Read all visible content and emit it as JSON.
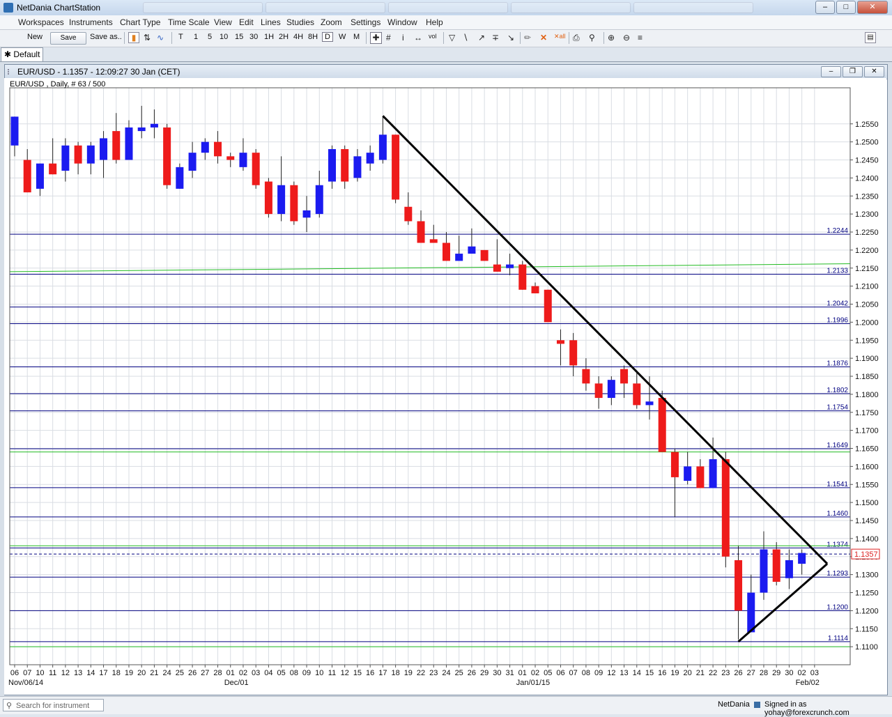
{
  "app": {
    "title": "NetDania ChartStation"
  },
  "menu": [
    "Workspaces",
    "Instruments",
    "Chart Type",
    "Time Scale",
    "View",
    "Edit",
    "Lines",
    "Studies",
    "Zoom",
    "Settings",
    "Window",
    "Help"
  ],
  "toolbar": {
    "new_label": "New",
    "save_label": "Save",
    "saveas_label": "Save as..",
    "timeframes": [
      "T",
      "1",
      "5",
      "10",
      "15",
      "30",
      "1H",
      "2H",
      "4H",
      "8H",
      "D",
      "W",
      "M"
    ]
  },
  "workspace_tab": {
    "label": "Default"
  },
  "chart_window": {
    "title": "EUR/USD - 1.1357 - 12:09:27  30 Jan (CET)"
  },
  "status": {
    "search_placeholder": "Search for instrument",
    "provider": "NetDania",
    "signed_in": "Signed in as yohay@forexcrunch.com"
  },
  "colors": {
    "up": "#1b1bf0",
    "down": "#ee1b1b",
    "hline": "#000080",
    "ma": "#22bb22",
    "trend": "#000000"
  },
  "chart_data": {
    "type": "candlestick",
    "info_label": "EUR/USD , Daily, # 63 / 500",
    "ylim": [
      1.105,
      1.265
    ],
    "y_ticks": [
      "1.1100",
      "1.1150",
      "1.1200",
      "1.1250",
      "1.1300",
      "1.1350",
      "1.1400",
      "1.1450",
      "1.1500",
      "1.1550",
      "1.1600",
      "1.1650",
      "1.1700",
      "1.1750",
      "1.1800",
      "1.1850",
      "1.1900",
      "1.1950",
      "1.2000",
      "1.2050",
      "1.2100",
      "1.2150",
      "1.2200",
      "1.2250",
      "1.2300",
      "1.2350",
      "1.2400",
      "1.2450",
      "1.2500",
      "1.2550"
    ],
    "x_day_labels": [
      "06",
      "07",
      "10",
      "11",
      "12",
      "13",
      "14",
      "17",
      "18",
      "19",
      "20",
      "21",
      "24",
      "25",
      "26",
      "27",
      "28",
      "01",
      "02",
      "03",
      "04",
      "05",
      "08",
      "09",
      "10",
      "11",
      "12",
      "15",
      "16",
      "17",
      "18",
      "19",
      "22",
      "23",
      "24",
      "25",
      "26",
      "29",
      "30",
      "31",
      "01",
      "02",
      "05",
      "06",
      "07",
      "08",
      "09",
      "12",
      "13",
      "14",
      "15",
      "16",
      "19",
      "20",
      "21",
      "22",
      "23",
      "26",
      "27",
      "28",
      "29",
      "30",
      "02",
      "03"
    ],
    "x_month_labels": [
      {
        "index": 0,
        "text": "Nov/06/14"
      },
      {
        "index": 17,
        "text": "Dec/01"
      },
      {
        "index": 40,
        "text": "Jan/01/15"
      },
      {
        "index": 62,
        "text": "Feb/02"
      }
    ],
    "candles": [
      {
        "o": 1.249,
        "h": 1.256,
        "l": 1.246,
        "c": 1.257
      },
      {
        "o": 1.245,
        "h": 1.248,
        "l": 1.236,
        "c": 1.236
      },
      {
        "o": 1.237,
        "h": 1.244,
        "l": 1.235,
        "c": 1.244
      },
      {
        "o": 1.244,
        "h": 1.251,
        "l": 1.241,
        "c": 1.241
      },
      {
        "o": 1.242,
        "h": 1.251,
        "l": 1.239,
        "c": 1.249
      },
      {
        "o": 1.249,
        "h": 1.25,
        "l": 1.241,
        "c": 1.244
      },
      {
        "o": 1.244,
        "h": 1.25,
        "l": 1.241,
        "c": 1.249
      },
      {
        "o": 1.245,
        "h": 1.253,
        "l": 1.24,
        "c": 1.251
      },
      {
        "o": 1.253,
        "h": 1.258,
        "l": 1.244,
        "c": 1.245
      },
      {
        "o": 1.245,
        "h": 1.256,
        "l": 1.245,
        "c": 1.254
      },
      {
        "o": 1.253,
        "h": 1.26,
        "l": 1.251,
        "c": 1.254
      },
      {
        "o": 1.254,
        "h": 1.259,
        "l": 1.251,
        "c": 1.255
      },
      {
        "o": 1.254,
        "h": 1.255,
        "l": 1.237,
        "c": 1.238
      },
      {
        "o": 1.237,
        "h": 1.244,
        "l": 1.237,
        "c": 1.243
      },
      {
        "o": 1.242,
        "h": 1.25,
        "l": 1.24,
        "c": 1.247
      },
      {
        "o": 1.247,
        "h": 1.251,
        "l": 1.245,
        "c": 1.25
      },
      {
        "o": 1.25,
        "h": 1.253,
        "l": 1.244,
        "c": 1.246
      },
      {
        "o": 1.246,
        "h": 1.247,
        "l": 1.243,
        "c": 1.245
      },
      {
        "o": 1.243,
        "h": 1.251,
        "l": 1.242,
        "c": 1.247
      },
      {
        "o": 1.247,
        "h": 1.248,
        "l": 1.237,
        "c": 1.238
      },
      {
        "o": 1.239,
        "h": 1.24,
        "l": 1.229,
        "c": 1.23
      },
      {
        "o": 1.23,
        "h": 1.246,
        "l": 1.228,
        "c": 1.238
      },
      {
        "o": 1.238,
        "h": 1.239,
        "l": 1.227,
        "c": 1.228
      },
      {
        "o": 1.229,
        "h": 1.235,
        "l": 1.225,
        "c": 1.231
      },
      {
        "o": 1.23,
        "h": 1.242,
        "l": 1.229,
        "c": 1.238
      },
      {
        "o": 1.239,
        "h": 1.249,
        "l": 1.237,
        "c": 1.248
      },
      {
        "o": 1.248,
        "h": 1.249,
        "l": 1.237,
        "c": 1.239
      },
      {
        "o": 1.24,
        "h": 1.248,
        "l": 1.239,
        "c": 1.246
      },
      {
        "o": 1.244,
        "h": 1.249,
        "l": 1.242,
        "c": 1.247
      },
      {
        "o": 1.245,
        "h": 1.257,
        "l": 1.244,
        "c": 1.252
      },
      {
        "o": 1.252,
        "h": 1.251,
        "l": 1.233,
        "c": 1.234
      },
      {
        "o": 1.232,
        "h": 1.236,
        "l": 1.227,
        "c": 1.228
      },
      {
        "o": 1.228,
        "h": 1.231,
        "l": 1.223,
        "c": 1.222
      },
      {
        "o": 1.223,
        "h": 1.227,
        "l": 1.222,
        "c": 1.222
      },
      {
        "o": 1.222,
        "h": 1.225,
        "l": 1.217,
        "c": 1.217
      },
      {
        "o": 1.217,
        "h": 1.224,
        "l": 1.217,
        "c": 1.219
      },
      {
        "o": 1.219,
        "h": 1.226,
        "l": 1.219,
        "c": 1.221
      },
      {
        "o": 1.22,
        "h": 1.22,
        "l": 1.217,
        "c": 1.217
      },
      {
        "o": 1.216,
        "h": 1.223,
        "l": 1.215,
        "c": 1.214
      },
      {
        "o": 1.215,
        "h": 1.219,
        "l": 1.213,
        "c": 1.216
      },
      {
        "o": 1.216,
        "h": 1.217,
        "l": 1.209,
        "c": 1.209
      },
      {
        "o": 1.21,
        "h": 1.211,
        "l": 1.208,
        "c": 1.208
      },
      {
        "o": 1.209,
        "h": 1.209,
        "l": 1.2,
        "c": 1.2
      },
      {
        "o": 1.195,
        "h": 1.198,
        "l": 1.188,
        "c": 1.194
      },
      {
        "o": 1.195,
        "h": 1.197,
        "l": 1.185,
        "c": 1.188
      },
      {
        "o": 1.187,
        "h": 1.19,
        "l": 1.181,
        "c": 1.183
      },
      {
        "o": 1.183,
        "h": 1.185,
        "l": 1.176,
        "c": 1.179
      },
      {
        "o": 1.179,
        "h": 1.185,
        "l": 1.177,
        "c": 1.184
      },
      {
        "o": 1.187,
        "h": 1.188,
        "l": 1.179,
        "c": 1.183
      },
      {
        "o": 1.183,
        "h": 1.186,
        "l": 1.176,
        "c": 1.177
      },
      {
        "o": 1.177,
        "h": 1.185,
        "l": 1.173,
        "c": 1.178
      },
      {
        "o": 1.179,
        "h": 1.181,
        "l": 1.164,
        "c": 1.164
      },
      {
        "o": 1.164,
        "h": 1.165,
        "l": 1.146,
        "c": 1.157
      },
      {
        "o": 1.156,
        "h": 1.164,
        "l": 1.155,
        "c": 1.16
      },
      {
        "o": 1.16,
        "h": 1.162,
        "l": 1.154,
        "c": 1.154
      },
      {
        "o": 1.154,
        "h": 1.168,
        "l": 1.154,
        "c": 1.162
      },
      {
        "o": 1.162,
        "h": 1.164,
        "l": 1.132,
        "c": 1.135
      },
      {
        "o": 1.134,
        "h": 1.138,
        "l": 1.112,
        "c": 1.12
      },
      {
        "o": 1.114,
        "h": 1.13,
        "l": 1.115,
        "c": 1.125
      },
      {
        "o": 1.125,
        "h": 1.142,
        "l": 1.123,
        "c": 1.137
      },
      {
        "o": 1.137,
        "h": 1.139,
        "l": 1.127,
        "c": 1.128
      },
      {
        "o": 1.129,
        "h": 1.137,
        "l": 1.126,
        "c": 1.134
      },
      {
        "o": 1.133,
        "h": 1.137,
        "l": 1.13,
        "c": 1.136
      }
    ],
    "horizontal_lines": [
      {
        "value": 1.2244,
        "label": "1.2244"
      },
      {
        "value": 1.2133,
        "label": "1.2133"
      },
      {
        "value": 1.2042,
        "label": "1.2042"
      },
      {
        "value": 1.1996,
        "label": "1.1996"
      },
      {
        "value": 1.1876,
        "label": "1.1876"
      },
      {
        "value": 1.1802,
        "label": "1.1802"
      },
      {
        "value": 1.1754,
        "label": "1.1754"
      },
      {
        "value": 1.1649,
        "label": "1.1649"
      },
      {
        "value": 1.1541,
        "label": "1.1541"
      },
      {
        "value": 1.146,
        "label": "1.1460"
      },
      {
        "value": 1.1374,
        "label": "1.1374"
      },
      {
        "value": 1.1293,
        "label": "1.1293"
      },
      {
        "value": 1.12,
        "label": "1.1200"
      },
      {
        "value": 1.1114,
        "label": "1.1114"
      }
    ],
    "green_lines": [
      {
        "from": {
          "i": 0,
          "v": 1.214
        },
        "to": {
          "i": 63,
          "v": 1.2162
        }
      },
      {
        "from": {
          "i": 0,
          "v": 1.164
        },
        "to": {
          "i": 63,
          "v": 1.164
        }
      },
      {
        "from": {
          "i": 0,
          "v": 1.138
        },
        "to": {
          "i": 63,
          "v": 1.138
        }
      },
      {
        "from": {
          "i": 0,
          "v": 1.11
        },
        "to": {
          "i": 63,
          "v": 1.11
        }
      }
    ],
    "trend_lines": [
      {
        "from": {
          "i": 29,
          "v": 1.2572
        },
        "to": {
          "i": 64,
          "v": 1.133
        }
      },
      {
        "from": {
          "i": 57,
          "v": 1.1114
        },
        "to": {
          "i": 64,
          "v": 1.133
        }
      }
    ],
    "current_price": {
      "value": 1.1357,
      "label": "1.1357"
    }
  }
}
